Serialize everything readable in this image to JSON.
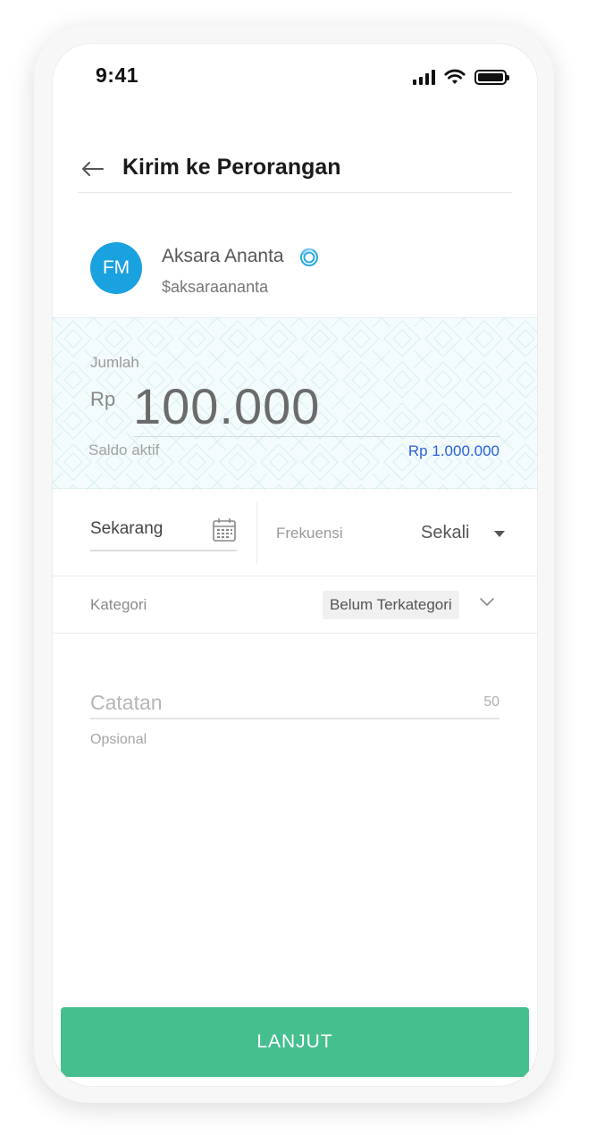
{
  "status_bar": {
    "time": "9:41"
  },
  "header": {
    "title": "Kirim ke Perorangan",
    "back_icon": "arrow-left-icon"
  },
  "recipient": {
    "initials": "FM",
    "name": "Aksara Ananta",
    "handle": "$aksaraananta",
    "verified_icon": "verified-badge-icon"
  },
  "amount": {
    "label": "Jumlah",
    "currency": "Rp",
    "value": "100.000",
    "balance_label": "Saldo aktif",
    "balance_value": "Rp 1.000.000"
  },
  "schedule": {
    "date_value": "Sekarang",
    "frequency_label": "Frekuensi",
    "frequency_value": "Sekali"
  },
  "category": {
    "label": "Kategori",
    "value": "Belum Terkategori"
  },
  "note": {
    "placeholder": "Catatan",
    "value": "",
    "max_length": "50",
    "hint": "Opsional"
  },
  "actions": {
    "next_label": "LANJUT"
  },
  "colors": {
    "primary_button": "#46bf8e",
    "avatar": "#1aa1e0",
    "balance_link": "#2a62d6"
  }
}
